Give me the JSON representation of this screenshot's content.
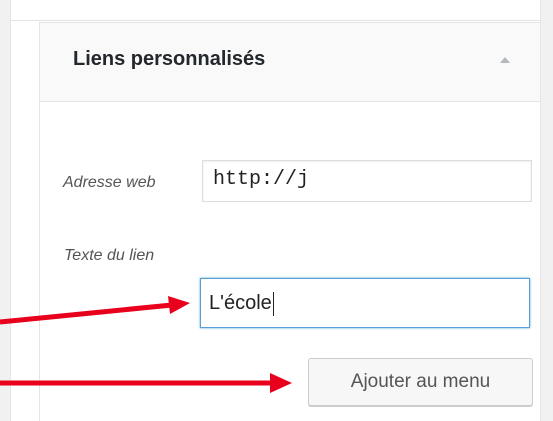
{
  "section": {
    "title": "Liens personnalisés"
  },
  "form": {
    "url_label": "Adresse web",
    "url_value": "http://j",
    "text_label": "Texte du lien",
    "text_value": "L'école",
    "add_button_label": "Ajouter au menu"
  },
  "colors": {
    "arrow": "#e8001c",
    "focus_border": "#5b9dd9"
  }
}
